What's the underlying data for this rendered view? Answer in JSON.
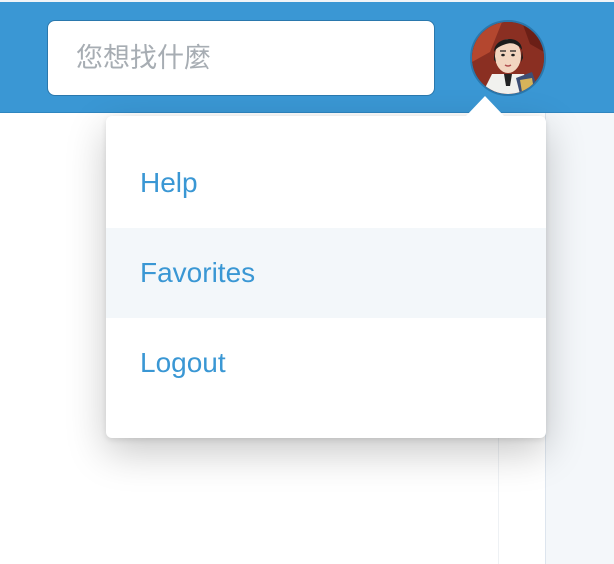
{
  "header": {
    "search": {
      "placeholder": "您想找什麼",
      "value": ""
    },
    "avatar": {
      "icon": "user-avatar"
    }
  },
  "dropdown": {
    "items": [
      {
        "label": "Help"
      },
      {
        "label": "Favorites",
        "highlighted": true
      },
      {
        "label": "Logout"
      }
    ]
  },
  "colors": {
    "header_bg": "#3a97d4",
    "link": "#3a97d4",
    "hover_bg": "#f3f7fa"
  }
}
